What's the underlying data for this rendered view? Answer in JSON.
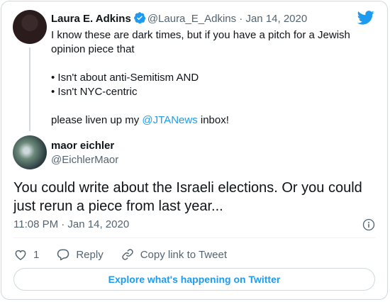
{
  "parent_tweet": {
    "author_name": "Laura E. Adkins",
    "handle": "@Laura_E_Adkins",
    "separator": " · ",
    "date": "Jan 14, 2020",
    "line1": "I know these are dark times, but if you have a pitch for a Jewish opinion piece that",
    "bullet1": "• Isn't about anti-Semitism AND",
    "bullet2": "• Isn't NYC-centric",
    "closing_before": "please liven up my ",
    "closing_mention": "@JTANews",
    "closing_after": " inbox!"
  },
  "reply_tweet": {
    "author_name": "maor eichler",
    "handle": "@EichlerMaor",
    "text": "You could write about the Israeli elections. Or you could just rerun a piece from last year...",
    "timestamp": "11:08 PM · Jan 14, 2020"
  },
  "actions": {
    "like_count": "1",
    "reply_label": "Reply",
    "copy_link_label": "Copy link to Tweet"
  },
  "explore_button_label": "Explore what's happening on Twitter",
  "colors": {
    "accent": "#1d9bf0",
    "text": "#0f1419",
    "muted": "#536471",
    "border": "#cfd9de"
  },
  "icons": [
    "twitter-bird-icon",
    "verified-badge-icon",
    "info-icon",
    "heart-icon",
    "reply-icon",
    "link-icon"
  ]
}
